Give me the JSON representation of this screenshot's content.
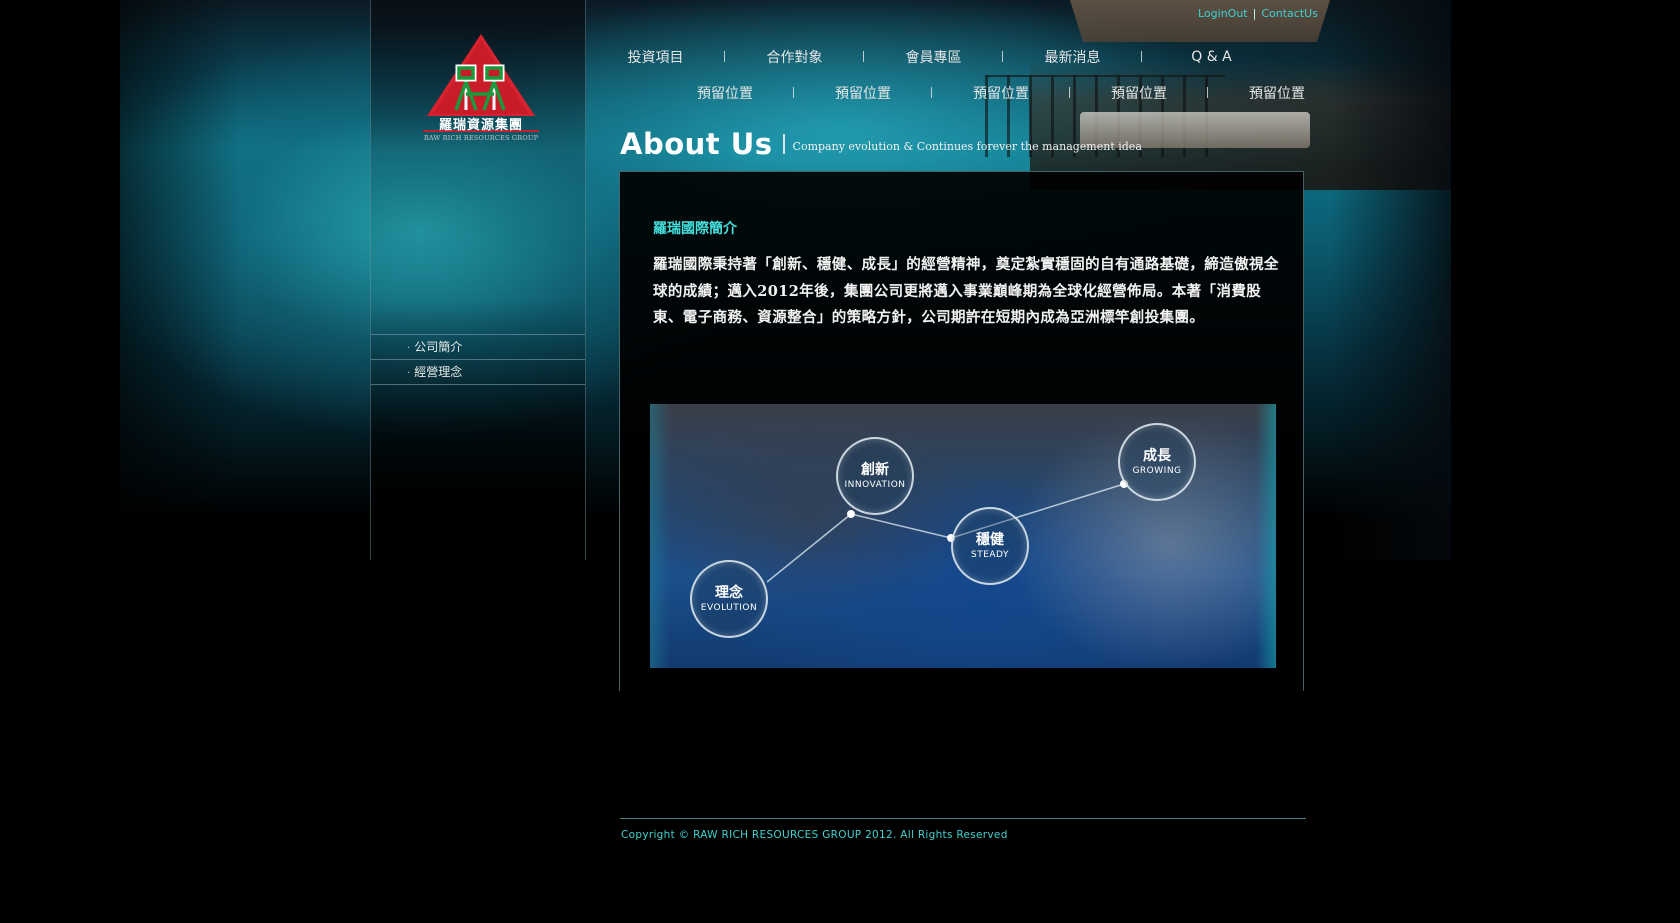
{
  "top_links": {
    "login_out": "LoginOut",
    "separator": "|",
    "contact_us": "ContactUs"
  },
  "nav": {
    "row1": [
      "投資項目",
      "合作對象",
      "會員專區",
      "最新消息",
      "Q & A"
    ],
    "row2": [
      "預留位置",
      "預留位置",
      "預留位置",
      "預留位置",
      "預留位置"
    ]
  },
  "logo": {
    "title": "羅瑞資源集團",
    "subtitle": "RAW RICH RESOURCES GROUP",
    "colors": {
      "red": "#d8222f",
      "green": "#1a9a3a"
    }
  },
  "sidebar": {
    "items": [
      {
        "bullet": "·",
        "label": "公司簡介"
      },
      {
        "bullet": "·",
        "label": "經營理念"
      }
    ]
  },
  "about": {
    "title": "About Us",
    "subtitle": "Company evolution & Continues forever the management idea"
  },
  "intro": {
    "heading": "羅瑞國際簡介",
    "paragraph": "羅瑞國際秉持著「創新、穩健、成長」的經營精神，奠定紮實穩固的自有通路基礎，締造傲視全球的成績；邁入2012年後，集團公司更將邁入事業巔峰期為全球化經營佈局。本著「消費股東、電子商務、資源整合」的策略方針，公司期許在短期內成為亞洲標竿創投集團。"
  },
  "visual": {
    "nodes": [
      {
        "cn": "理念",
        "en": "EVOLUTION"
      },
      {
        "cn": "創新",
        "en": "INNOVATION"
      },
      {
        "cn": "穩健",
        "en": "STEADY"
      },
      {
        "cn": "成長",
        "en": "GROWING"
      }
    ]
  },
  "footer": {
    "copyright": "Copyright © RAW RICH RESOURCES GROUP 2012. All Rights Reserved"
  },
  "colors": {
    "accent": "#3fd1cf",
    "heading": "#45e0dd",
    "background": "#000000"
  }
}
